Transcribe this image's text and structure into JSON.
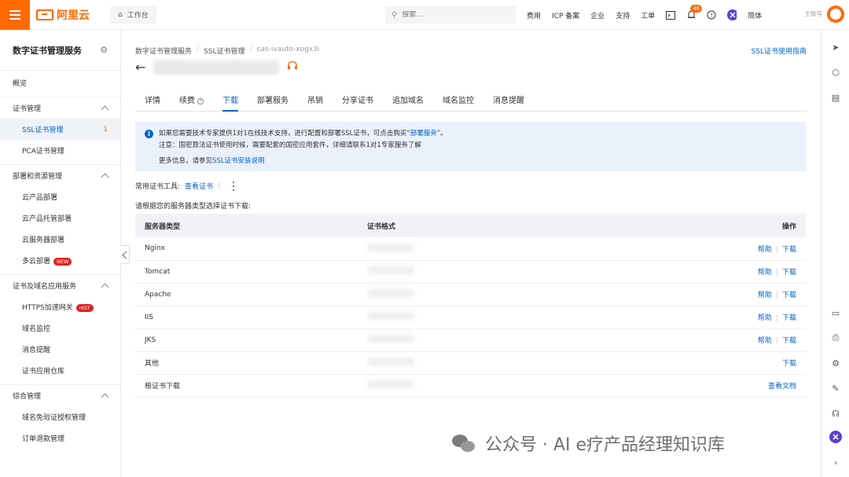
{
  "topbar": {
    "brand": "阿里云",
    "workbench": "工作台",
    "search_placeholder": "搜索...",
    "nav": [
      "费用",
      "ICP 备案",
      "企业",
      "支持",
      "工单"
    ],
    "notification_count": "46",
    "lang": "简体",
    "account_label": "主账号"
  },
  "sidebar": {
    "title": "数字证书管理服务",
    "overview": "概览",
    "groups": [
      {
        "label": "证书管理",
        "items": [
          {
            "label": "SSL证书管理",
            "count": "1"
          },
          {
            "label": "PCA证书管理"
          }
        ]
      },
      {
        "label": "部署和资源管理",
        "items": [
          {
            "label": "云产品部署"
          },
          {
            "label": "云产品托管部署"
          },
          {
            "label": "云服务器部署"
          },
          {
            "label": "多云部署",
            "tag": "NEW"
          }
        ]
      },
      {
        "label": "证书及域名应用服务",
        "items": [
          {
            "label": "HTTPS加速网关",
            "tag": "HOT"
          },
          {
            "label": "域名监控"
          },
          {
            "label": "消息提醒"
          },
          {
            "label": "证书应用仓库"
          }
        ]
      },
      {
        "label": "综合管理",
        "items": [
          {
            "label": "域名免验证授权管理"
          },
          {
            "label": "订单退款管理"
          }
        ]
      }
    ]
  },
  "breadcrumb": [
    "数字证书管理服务",
    "SSL证书管理",
    "cas-ivauto-xogx3i"
  ],
  "guide_link": "SSL证书使用指南",
  "tabs": [
    "详情",
    "续费",
    "下载",
    "部署服务",
    "吊销",
    "分享证书",
    "追加域名",
    "域名监控",
    "消息提醒"
  ],
  "active_tab": "下载",
  "notice": {
    "line1_prefix": "如果您需要技术专家提供1对1在线技术支持，进行配置和部署SSL证书，可点击购买“",
    "line1_link": "部署服务",
    "line1_suffix": "”。",
    "line2": "注意：国密算法证书使用时候，需要配套的国密应用套件，详细请联系1对1专家服务了解",
    "line3_prefix": "更多信息，请参见",
    "line3_link": "SSL证书安装说明"
  },
  "tools": {
    "label": "常用证书工具:",
    "link": "查看证书"
  },
  "select_hint": "请根据您的服务器类型选择证书下载:",
  "table": {
    "headers": [
      "服务器类型",
      "证书格式",
      "操作"
    ],
    "rows": [
      {
        "server": "Nginx",
        "help": "帮助",
        "download": "下载"
      },
      {
        "server": "Tomcat",
        "help": "帮助",
        "download": "下载"
      },
      {
        "server": "Apache",
        "help": "帮助",
        "download": "下载"
      },
      {
        "server": "IIS",
        "help": "帮助",
        "download": "下载"
      },
      {
        "server": "JKS",
        "help": "帮助",
        "download": "下载"
      },
      {
        "server": "其他",
        "download": "下载"
      },
      {
        "server": "根证书下载",
        "doc": "查看文档"
      }
    ]
  },
  "watermark": "公众号 · AI e疗产品经理知识库"
}
